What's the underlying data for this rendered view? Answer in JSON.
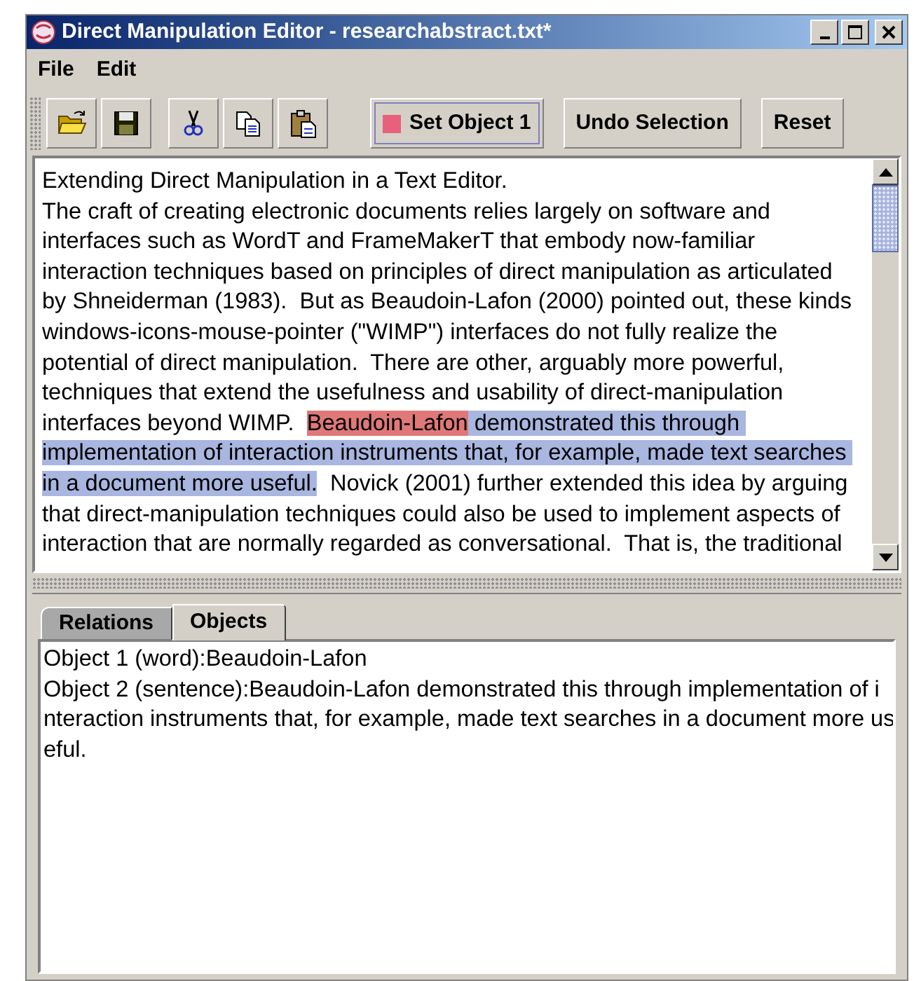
{
  "window": {
    "title": "Direct Manipulation Editor - researchabstract.txt*"
  },
  "menu": [
    {
      "label": "File"
    },
    {
      "label": "Edit"
    }
  ],
  "toolbar": {
    "icon_groups": [
      [
        {
          "kind": "open"
        },
        {
          "kind": "save"
        }
      ],
      [
        {
          "kind": "cut"
        },
        {
          "kind": "copy"
        },
        {
          "kind": "paste"
        }
      ]
    ],
    "buttons": [
      {
        "label": "Set Object 1",
        "color": "#e8607e"
      },
      {
        "label": "Undo Selection"
      },
      {
        "label": "Reset"
      }
    ]
  },
  "editor": {
    "lines": [
      [
        {
          "text": "Extending Direct Manipulation in a Text Editor.",
          "kind": "none"
        }
      ],
      [
        {
          "text": "The craft of creating electronic documents relies largely on software and",
          "kind": "none"
        }
      ],
      [
        {
          "text": "interfaces such as WordT and FrameMakerT that embody now-familiar",
          "kind": "none"
        }
      ],
      [
        {
          "text": "interaction techniques based on principles of direct manipulation as articulated",
          "kind": "none"
        }
      ],
      [
        {
          "text": "by Shneiderman (1983).  But as Beaudoin-Lafon (2000) pointed out, these kinds",
          "kind": "none"
        }
      ],
      [
        {
          "text": "windows-icons-mouse-pointer (\"WIMP\") interfaces do not fully realize the",
          "kind": "none"
        }
      ],
      [
        {
          "text": "potential of direct manipulation.  There are other, arguably more powerful,",
          "kind": "none"
        }
      ],
      [
        {
          "text": "techniques that extend the usefulness and usability of direct-manipulation",
          "kind": "none"
        }
      ],
      [
        {
          "text": "interfaces beyond WIMP.  ",
          "kind": "none"
        },
        {
          "text": "Beaudoin-Lafon",
          "kind": "word"
        },
        {
          "text": " demonstrated this through ",
          "kind": "sentence"
        }
      ],
      [
        {
          "text": "implementation of interaction instruments that, for example, made text searches ",
          "kind": "sentence"
        }
      ],
      [
        {
          "text": "in a document more useful.",
          "kind": "sentence"
        },
        {
          "text": "  Novick (2001) further extended this idea by arguing",
          "kind": "none"
        }
      ],
      [
        {
          "text": "that direct-manipulation techniques could also be used to implement aspects of",
          "kind": "none"
        }
      ],
      [
        {
          "text": "interaction that are normally regarded as conversational.  That is, the traditional",
          "kind": "none"
        }
      ]
    ]
  },
  "tabs": [
    {
      "label": "Relations",
      "selected": false
    },
    {
      "label": "Objects",
      "selected": true
    }
  ],
  "objects_panel": {
    "lines": [
      "Object 1 (word):Beaudoin-Lafon",
      "Object 2 (sentence):Beaudoin-Lafon demonstrated this through implementation of i",
      "nteraction instruments that, for example, made text searches in a document more us",
      "eful."
    ]
  }
}
